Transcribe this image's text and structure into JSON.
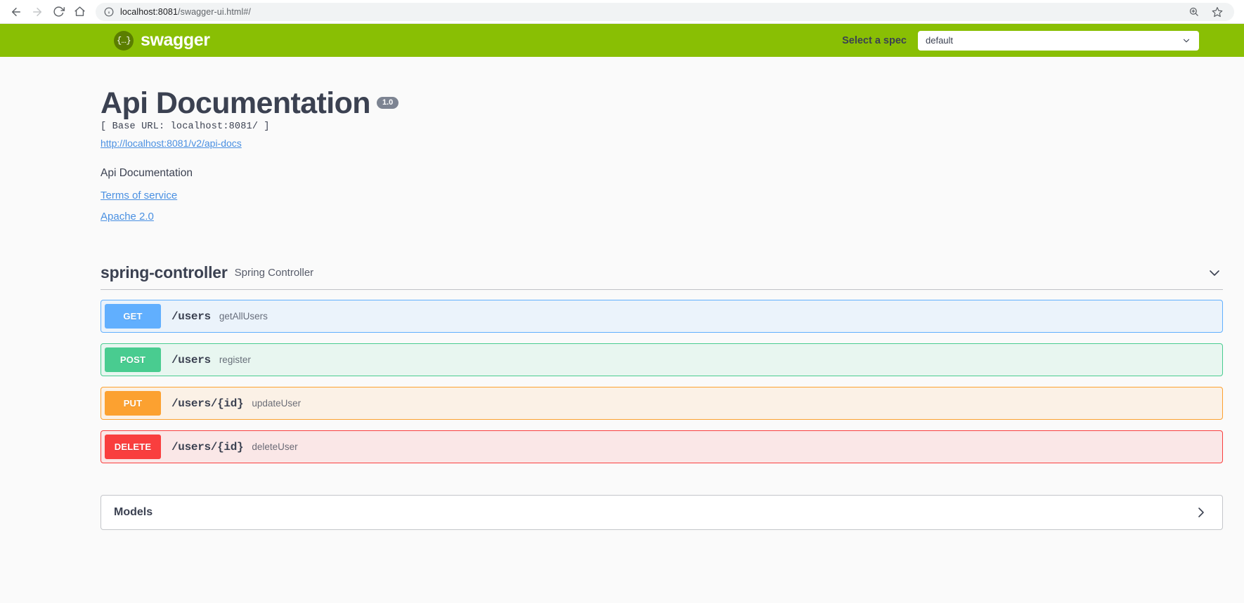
{
  "browser": {
    "back_icon": "back-arrow-icon",
    "forward_icon": "forward-arrow-icon",
    "reload_icon": "reload-icon",
    "home_icon": "home-icon",
    "site_info_icon": "info-circle-icon",
    "url_host": "localhost:8081",
    "url_path": "/swagger-ui.html#/",
    "url_full": "localhost:8081/swagger-ui.html#/",
    "zoom_icon": "zoom-in-icon",
    "bookmark_icon": "star-icon"
  },
  "topbar": {
    "logo_glyph": "{…}",
    "logo_text": "swagger",
    "spec_label": "Select a spec",
    "spec_value": "default",
    "spec_options": [
      "default"
    ],
    "chevron_icon": "chevron-down-icon",
    "bg_color": "#89bf04"
  },
  "info": {
    "title": "Api Documentation",
    "version": "1.0",
    "base_url": "[ Base URL: localhost:8081/ ]",
    "docs_link": "http://localhost:8081/v2/api-docs",
    "description": "Api Documentation",
    "terms_link": "Terms of service",
    "license_link": "Apache 2.0"
  },
  "tag": {
    "name": "spring-controller",
    "description": "Spring Controller",
    "chevron_icon": "chevron-down-icon",
    "operations": [
      {
        "method": "GET",
        "path": "/users",
        "summary": "getAllUsers",
        "color": "#61affe",
        "bg": "#ebf3fb"
      },
      {
        "method": "POST",
        "path": "/users",
        "summary": "register",
        "color": "#49cc90",
        "bg": "#e8f6f0"
      },
      {
        "method": "PUT",
        "path": "/users/{id}",
        "summary": "updateUser",
        "color": "#fca130",
        "bg": "#fbf1e6"
      },
      {
        "method": "DELETE",
        "path": "/users/{id}",
        "summary": "deleteUser",
        "color": "#f93e3e",
        "bg": "#fae7e7"
      }
    ]
  },
  "models": {
    "title": "Models",
    "chevron_icon": "chevron-right-icon"
  }
}
